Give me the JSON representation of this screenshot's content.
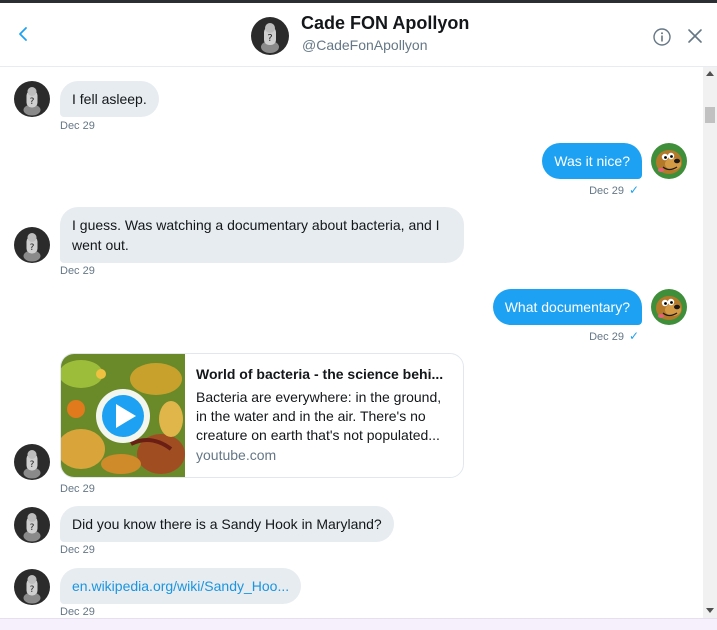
{
  "header": {
    "name": "Cade FON Apollyon",
    "handle": "@CadeFonApollyon"
  },
  "messages": [
    {
      "direction": "in",
      "text": "I fell asleep.",
      "time": "Dec 29"
    },
    {
      "direction": "out",
      "text": "Was it nice?",
      "time": "Dec 29"
    },
    {
      "direction": "in",
      "text": "I guess. Was watching a documentary about bacteria, and I went out.",
      "time": "Dec 29"
    },
    {
      "direction": "out",
      "text": "What documentary?",
      "time": "Dec 29"
    },
    {
      "direction": "in",
      "card": {
        "title": "World of bacteria - the science behi...",
        "description": "Bacteria are everywhere: in the ground, in the water and in the air. There's no creature on earth that's not populated...",
        "domain": "youtube.com"
      },
      "time": "Dec 29"
    },
    {
      "direction": "in",
      "text": "Did you know there is a Sandy Hook in Maryland?",
      "time": "Dec 29"
    },
    {
      "direction": "in",
      "link": "en.wikipedia.org/wiki/Sandy_Hoo...",
      "time": "Dec 29"
    }
  ],
  "colors": {
    "accent": "#1da1f2",
    "incoming_bubble": "#e6ecf0",
    "link": "#1b95e0"
  },
  "icons": [
    "back-arrow-icon",
    "info-icon",
    "close-icon",
    "play-icon",
    "read-check-icon"
  ]
}
